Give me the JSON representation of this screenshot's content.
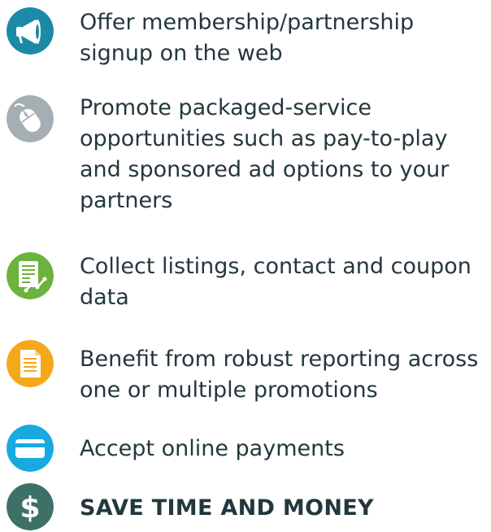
{
  "features": [
    {
      "text": "Offer membership/partnership signup on the web",
      "icon": "megaphone-icon",
      "color": "#1b8aa6"
    },
    {
      "text": "Promote packaged-service opportunities such as pay-to-play and sponsored ad options to your partners",
      "icon": "mouse-icon",
      "color": "#a5aeb3"
    },
    {
      "text": "Collect listings, contact and coupon data",
      "icon": "form-chart-icon",
      "color": "#6cb33e"
    },
    {
      "text": "Benefit from robust reporting across one or multiple promotions",
      "icon": "document-icon",
      "color": "#f6a81b"
    },
    {
      "text": "Accept online payments",
      "icon": "credit-card-icon",
      "color": "#19a9e1"
    },
    {
      "text": "SAVE TIME AND MONEY",
      "icon": "dollar-icon",
      "color": "#3d7168"
    }
  ],
  "colors": {
    "text": "#23383e",
    "background": "#ffffff"
  }
}
